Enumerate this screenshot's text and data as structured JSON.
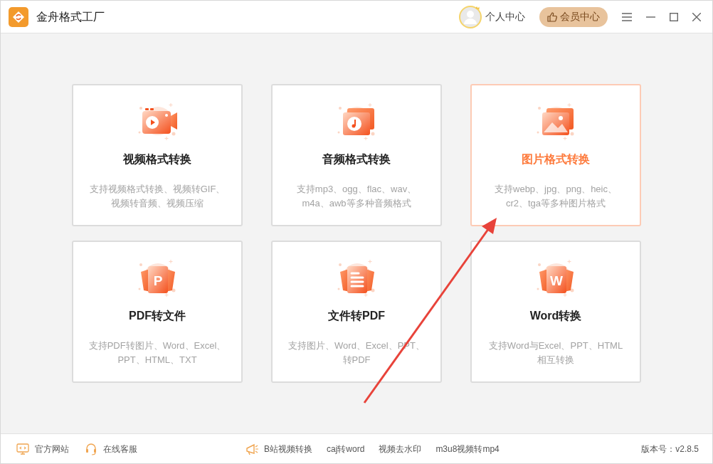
{
  "window": {
    "title": "金舟格式工厂"
  },
  "header": {
    "user_label": "个人中心",
    "vip_button": "会员中心"
  },
  "cards": [
    {
      "kind": "video",
      "title": "视频格式转换",
      "description": "支持视频格式转换、视频转GIF、视频转音频、视频压缩",
      "selected": false
    },
    {
      "kind": "audio",
      "title": "音频格式转换",
      "description": "支持mp3、ogg、flac、wav、m4a、awb等多种音频格式",
      "selected": false
    },
    {
      "kind": "image",
      "title": "图片格式转换",
      "description": "支持webp、jpg、png、heic、cr2、tga等多种图片格式",
      "selected": true
    },
    {
      "kind": "letter",
      "icon_letter": "P",
      "title": "PDF转文件",
      "description": "支持PDF转图片、Word、Excel、PPT、HTML、TXT",
      "selected": false
    },
    {
      "kind": "document",
      "title": "文件转PDF",
      "description": "支持图片、Word、Excel、PPT、转PDF",
      "selected": false
    },
    {
      "kind": "letter",
      "icon_letter": "W",
      "title": "Word转换",
      "description": "支持Word与Excel、PPT、HTML 相互转换",
      "selected": false
    }
  ],
  "status_bar": {
    "left_links": [
      {
        "kind": "website",
        "label": "官方网站"
      },
      {
        "kind": "support",
        "label": "在线客服"
      }
    ],
    "center_links": [
      {
        "label": "B站视频转换",
        "kind": "promo"
      },
      {
        "label": "caj转word",
        "kind": "plain"
      },
      {
        "label": "视频去水印",
        "kind": "plain"
      },
      {
        "label": "m3u8视频转mp4",
        "kind": "plain"
      }
    ],
    "version": "版本号：v2.8.5"
  }
}
